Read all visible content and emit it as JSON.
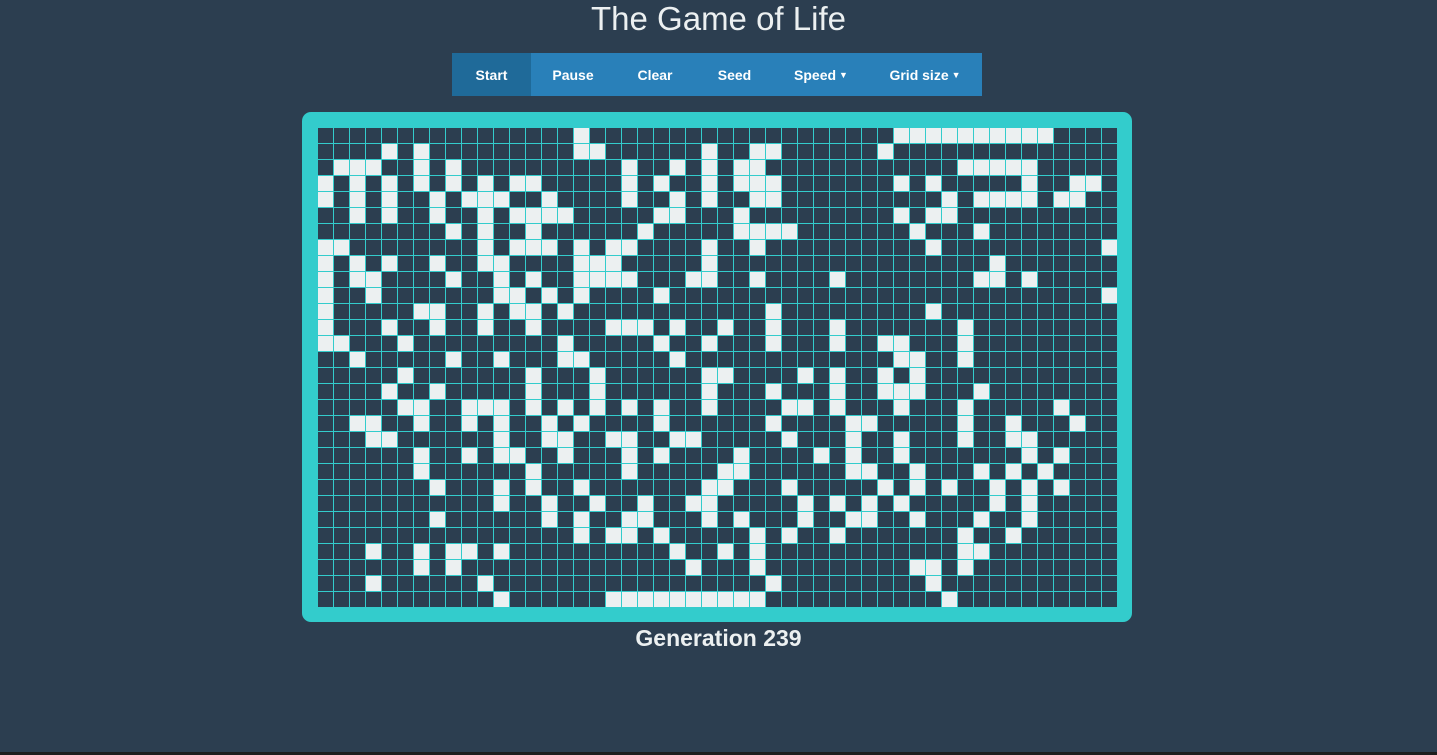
{
  "title": "The Game of Life",
  "toolbar": {
    "start": "Start",
    "pause": "Pause",
    "clear": "Clear",
    "seed": "Seed",
    "speed": "Speed",
    "grid_size": "Grid size",
    "active": "start"
  },
  "generation_text": "Generation 239",
  "colors": {
    "background": "#2c3e50",
    "toolbar": "#2980b9",
    "toolbar_active": "#1f6a99",
    "board_border": "#33cccc",
    "alive_cell": "#ecf0f1",
    "dead_cell": "#2c3e50"
  },
  "grid": {
    "rows": 30,
    "cols": 50,
    "alive": [
      "................#...................##########....",
      "....#.#.........##......#..##......#..............",
      ".###..#.#..........#..#.#.##............#####.....",
      "#.#.#.#.#.#.##.....#.#..#.###.......#.#.....#..##.",
      "#.#.#..#.###..#....#..#.#..##..........#.####.##..",
      "..#.#..#..#.####.....##...#.........#.##..........",
      "........#.#..#......#.....####.......#...#.......",
      "##........#.###.#.##....#..#..........#..........#",
      "#.#.#..#..##....###.....#.................#.......",
      "#.##....#..#.#..####...##..#....#........##.#.....",
      "#..#.......##.#.#....#...........................#",
      "#.....##..#.##.#............#.........#...........",
      "#...#..#..#..#....###.#..#..#...#.......#.........",
      "##...#.........#.....#..#...#...#..##...#.........",
      "..#.....#..#...##.....#.............##..#.........",
      ".....#.......#...#......##....#.#..#.#............",
      "....#..#.....#...#......#...#...#..###...#........",
      ".....##..###.#.#.#.#.#..#....##.#...#...#.....#...",
      "..##..#..#.#..#.#....#......#....##.....#..#...#..",
      "...##......#..##..##..##.....#...#..#...#..##.....",
      "......#..#.##..#...#.#....#....#.#..#.......#.#...",
      "......#......#.....#.....##......##..#...#.#.#....",
      ".......#...#.#..#.......##...#.....#.#.#..#.#.#...",
      "...........#..#..#..#..##.....#.#.#.#.....#.#.....",
      ".......#......#.#..##...#.#...#..##..#...#..#.....",
      "................#.##.#.....#.#..#.......#..#......",
      "...#..#.##.#..........#..#.#............##........",
      "......#.#..............#...#.........##.#.........",
      "...#......#.................#.........#...........",
      "...........#......##########...........#.........."
    ]
  }
}
